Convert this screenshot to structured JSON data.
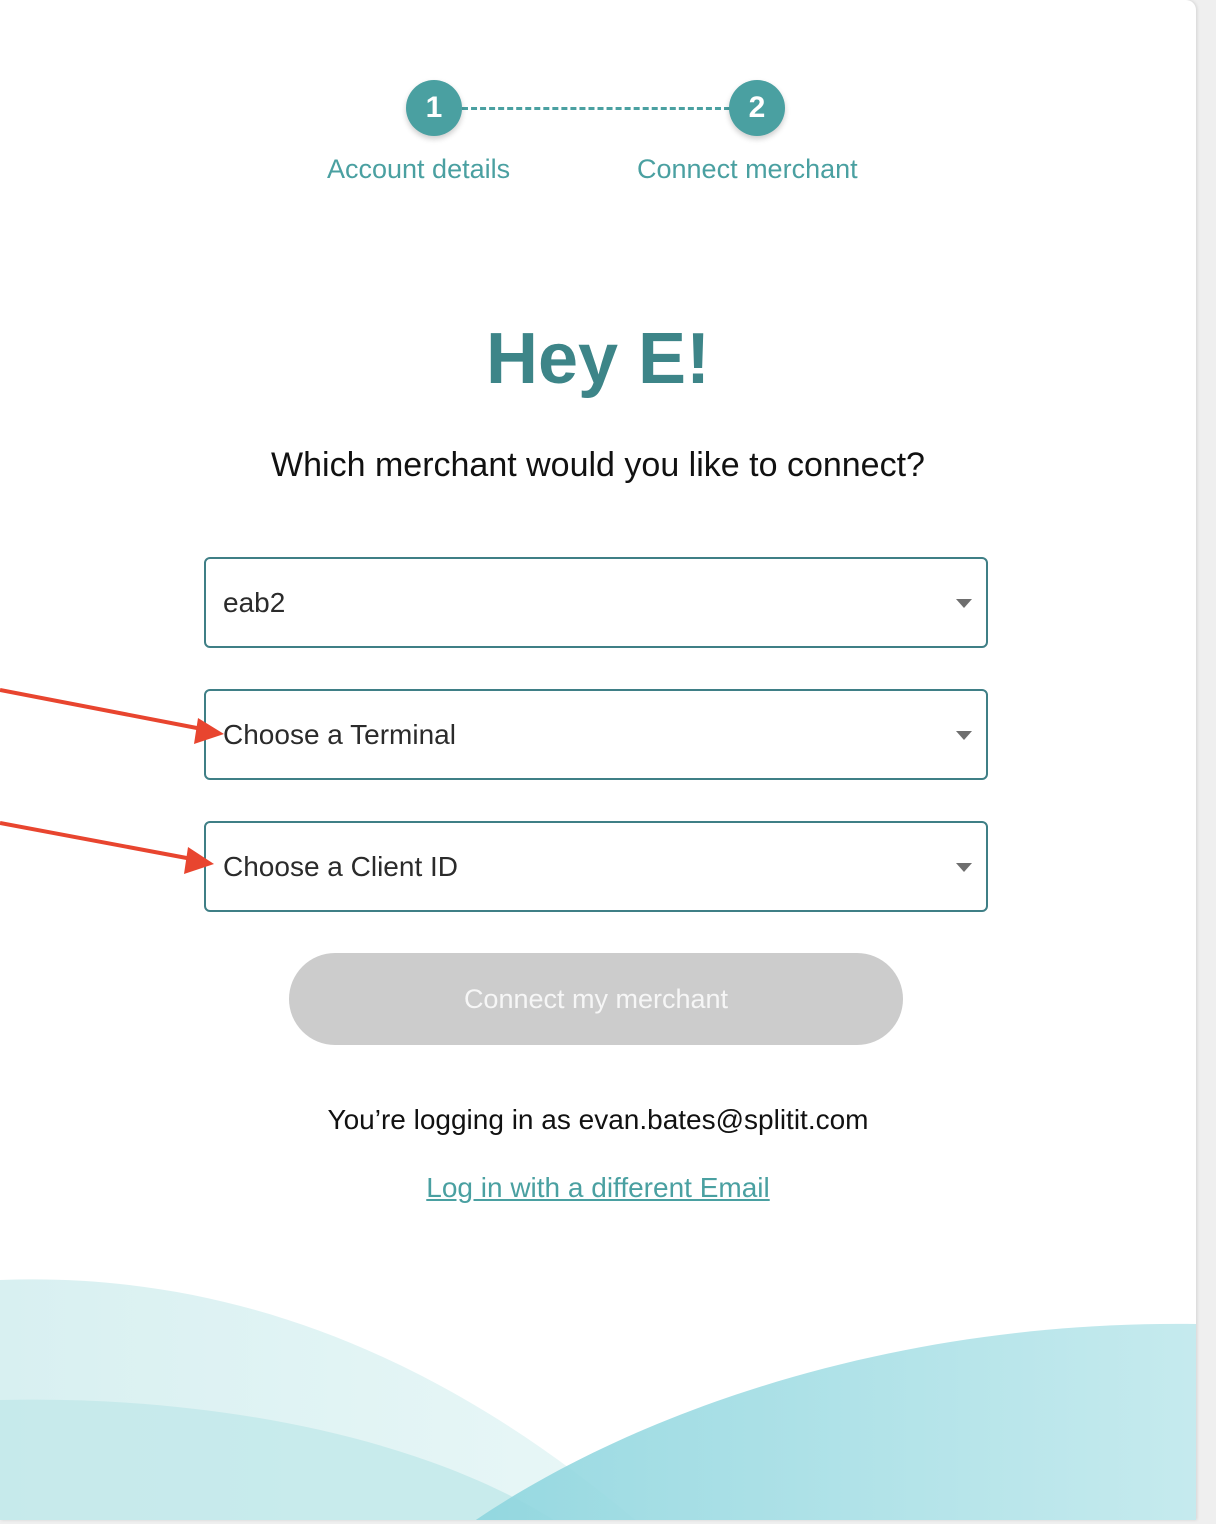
{
  "stepper": {
    "steps": [
      {
        "number": "1",
        "label": "Account details"
      },
      {
        "number": "2",
        "label": "Connect merchant"
      }
    ]
  },
  "greeting": "Hey E!",
  "prompt": "Which merchant would you like to connect?",
  "form": {
    "merchant_value": "eab2",
    "terminal_placeholder": "Choose a Terminal",
    "client_id_placeholder": "Choose a Client ID",
    "connect_label": "Connect my merchant"
  },
  "login": {
    "info": "You’re logging in as evan.bates@splitit.com",
    "switch_label": "Log in with a different Email"
  },
  "colors": {
    "accent": "#4aa0a1",
    "heading": "#3d8588",
    "annotation_arrow": "#e8452f",
    "button_disabled": "#cccccc"
  },
  "icons": {
    "dropdown": "chevron-down-icon",
    "annotation": "arrow-icon"
  }
}
